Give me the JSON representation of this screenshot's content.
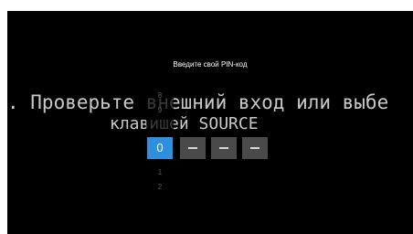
{
  "background_message": {
    "line1": ". Проверьте внешний вход или выбе",
    "line2": "клавишей SOURCE"
  },
  "pin_dialog": {
    "title": "Введите свой PIN-код",
    "picker_digits": {
      "above2": "8",
      "above1": "9",
      "selected": "0",
      "below1": "1",
      "below2": "2"
    },
    "slot_symbol": "—"
  },
  "colors": {
    "accent": "#2d8fde",
    "slot": "#4a4a4a",
    "background": "#000000"
  }
}
